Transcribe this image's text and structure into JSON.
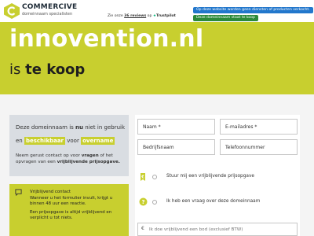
{
  "header": {
    "brand": "COMMERCIVE",
    "brand_sub": "domeinnaam specialisten",
    "reviews_prefix": "Zie onze",
    "reviews_count": "36 reviews",
    "reviews_suffix": "op",
    "trustpilot_star": "★",
    "trustpilot": "Trustpilot",
    "notice_info": "Op deze website worden geen diensten of producten verkocht.",
    "notice_sale": "Deze domeinnaam staat te koop"
  },
  "hero": {
    "domain": "innovention.nl",
    "forsale_prefix": "is",
    "forsale_bold": "te koop"
  },
  "info": {
    "l1_a": "Deze domeinnaam is",
    "l1_b": "nu",
    "l1_c": "niet in gebruik",
    "l2_a": "en",
    "l2_b": "beschikbaar",
    "l2_c": "voor",
    "l2_d": "overname",
    "l3_a": "Neem gerust contact op voor",
    "l3_b": "vragen",
    "l3_c": "of het",
    "l3_d": "opvragen van een",
    "l3_e": "vrijblijvende prijsopgave."
  },
  "contact_card": {
    "title": "Vrijblijvend contact",
    "line1": "Wanneer u het formulier invult, krijgt u",
    "line2": "binnen 48 uur een reactie.",
    "line3": "Een prijsopgave is altijd vrijblijvend en",
    "line4": "verplicht u tot niets."
  },
  "form": {
    "name": "Naam *",
    "email": "E-mailadres *",
    "company": "Bedrijfsnaam",
    "phone": "Telefoonnummer",
    "option_quote": "Stuur mij een vrijblijvende prijsopgave",
    "option_question": "Ik heb een vraag over deze domeinnaam",
    "bid_currency": "€",
    "bid_placeholder": "Ik doe vrijblijvend een bod (exclusief BTW)"
  },
  "icons": {
    "quote_option": "tag-icon",
    "question_option": "question-icon",
    "contact": "chat-icon"
  },
  "colors": {
    "accent": "#c8cf2f",
    "notice_blue": "#2277cc",
    "notice_green": "#2c8a3a",
    "trustpilot": "#00b67a"
  }
}
